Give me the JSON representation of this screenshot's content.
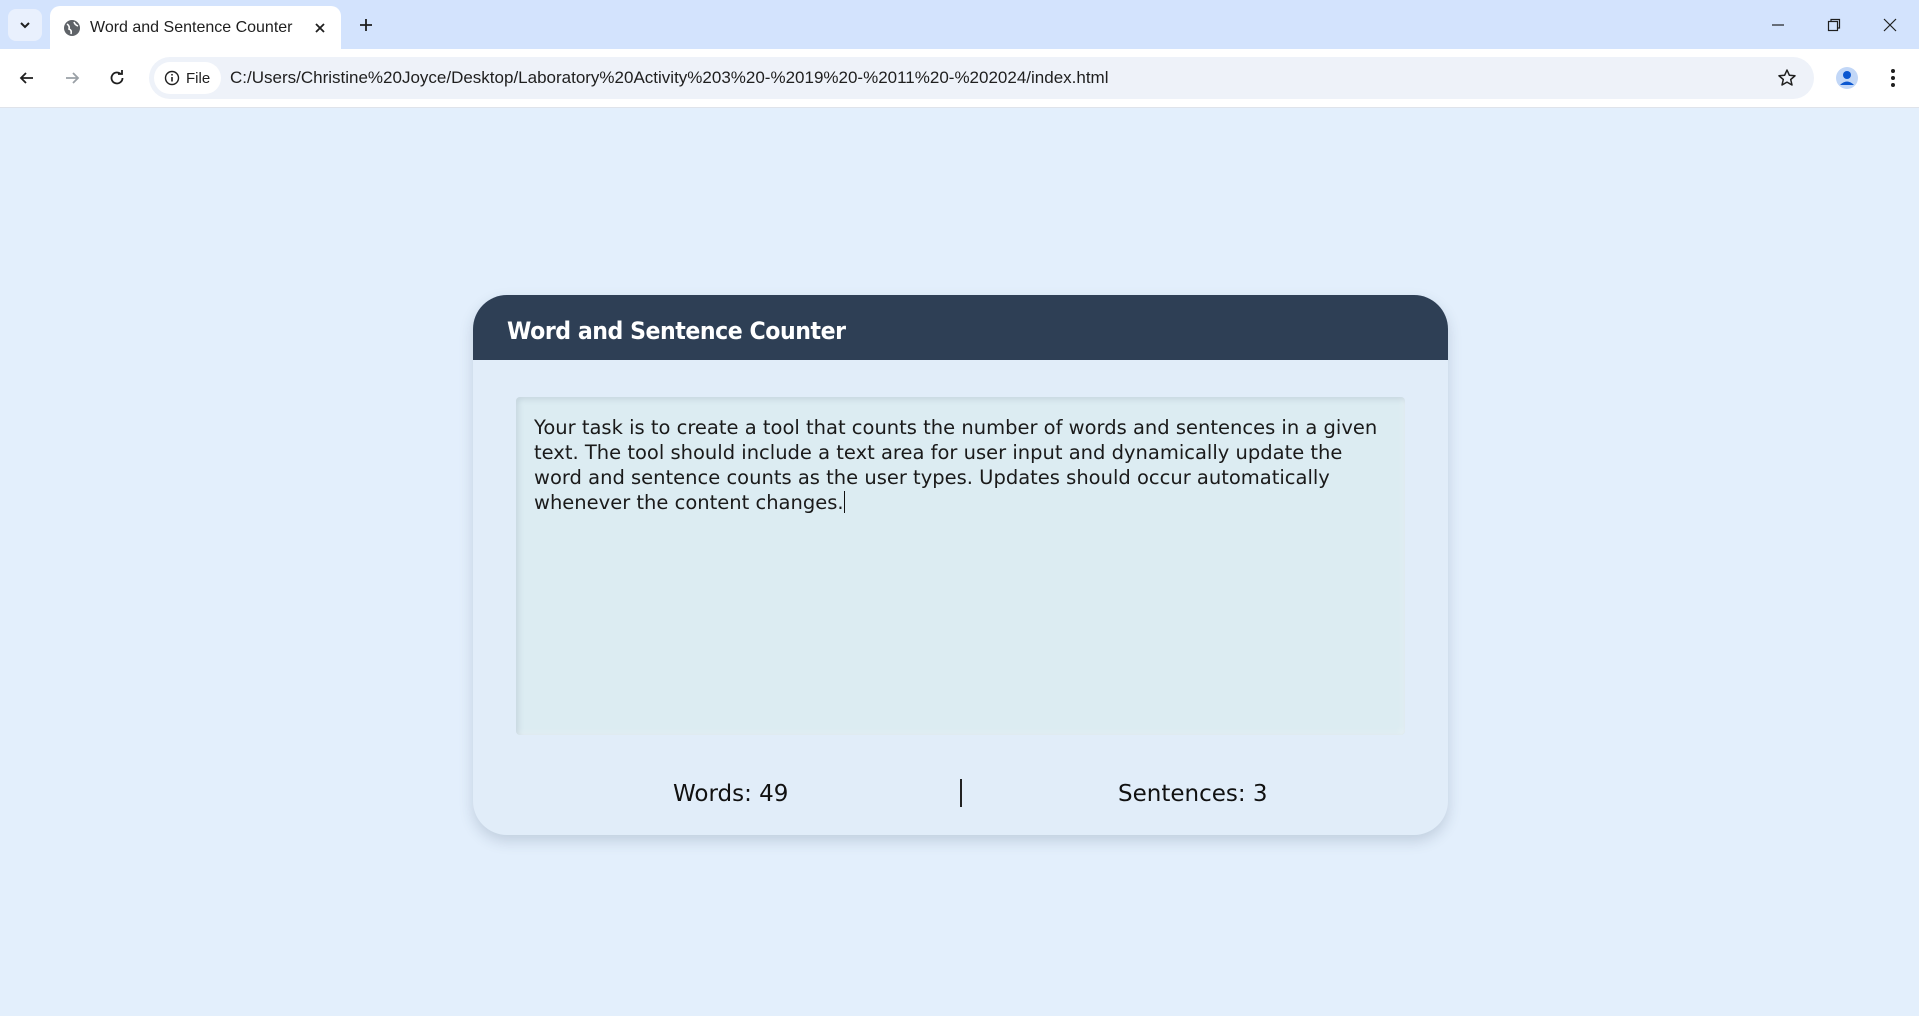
{
  "browser": {
    "tab": {
      "title": "Word and Sentence Counter"
    },
    "site_chip_label": "File",
    "url": "C:/Users/Christine%20Joyce/Desktop/Laboratory%20Activity%203%20-%2019%20-%2011%20-%202024/index.html"
  },
  "app": {
    "title": "Word and Sentence Counter",
    "textarea_value": "Your task is to create a tool that counts the number of words and sentences in a given text. The tool should include a text area for user input and dynamically update the word and sentence counts as the user types. Updates should occur automatically whenever the content changes.",
    "words_label": "Words: 49",
    "sentences_label": "Sentences: 3"
  },
  "colors": {
    "page_background": "#e3effc",
    "card_background": "#e1edf9",
    "header_background": "#2e3f55",
    "textarea_background": "#dcecf2",
    "tabbar_background": "#d3e3fd"
  }
}
